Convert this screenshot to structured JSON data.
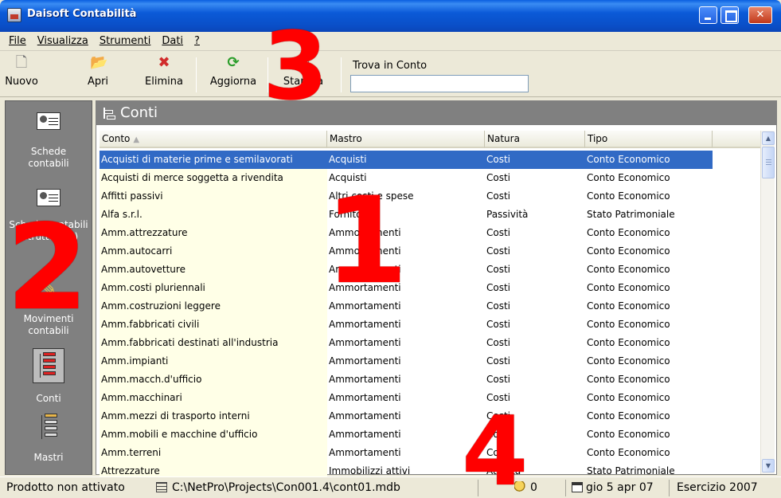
{
  "window": {
    "title": "Daisoft Contabilità"
  },
  "menu": [
    "File",
    "Visualizza",
    "Strumenti",
    "Dati",
    "?"
  ],
  "toolbar": {
    "new_label": "Nuovo",
    "open_label": "Apri",
    "delete_label": "Elimina",
    "refresh_label": "Aggiorna",
    "print_label": "Stampa",
    "find_label": "Trova in Conto",
    "find_value": ""
  },
  "sidebar": {
    "items": [
      {
        "label": "Schede contabili",
        "icon": "account-card-icon"
      },
      {
        "label": "Schede contabili (strutturate)",
        "icon": "account-card-icon"
      },
      {
        "label": "Movimenti contabili",
        "icon": "pencil-icon"
      },
      {
        "label": "Conti",
        "icon": "tree-red-icon"
      },
      {
        "label": "Mastri",
        "icon": "tree-icon"
      }
    ]
  },
  "panel": {
    "title": "Conti"
  },
  "table": {
    "columns": [
      "Conto",
      "Mastro",
      "Natura",
      "Tipo"
    ],
    "sort_indicator": "▲",
    "rows": [
      [
        "Acquisti di materie prime e semilavorati",
        "Acquisti",
        "Costi",
        "Conto Economico"
      ],
      [
        "Acquisti di merce soggetta a rivendita",
        "Acquisti",
        "Costi",
        "Conto Economico"
      ],
      [
        "Affitti passivi",
        "Altri costi e spese",
        "Costi",
        "Conto Economico"
      ],
      [
        "Alfa s.r.l.",
        "Fornitori",
        "Passività",
        "Stato Patrimoniale"
      ],
      [
        "Amm.attrezzature",
        "Ammortamenti",
        "Costi",
        "Conto Economico"
      ],
      [
        "Amm.autocarri",
        "Ammortamenti",
        "Costi",
        "Conto Economico"
      ],
      [
        "Amm.autovetture",
        "Ammortamenti",
        "Costi",
        "Conto Economico"
      ],
      [
        "Amm.costi pluriennali",
        "Ammortamenti",
        "Costi",
        "Conto Economico"
      ],
      [
        "Amm.costruzioni leggere",
        "Ammortamenti",
        "Costi",
        "Conto Economico"
      ],
      [
        "Amm.fabbricati civili",
        "Ammortamenti",
        "Costi",
        "Conto Economico"
      ],
      [
        "Amm.fabbricati destinati all'industria",
        "Ammortamenti",
        "Costi",
        "Conto Economico"
      ],
      [
        "Amm.impianti",
        "Ammortamenti",
        "Costi",
        "Conto Economico"
      ],
      [
        "Amm.macch.d'ufficio",
        "Ammortamenti",
        "Costi",
        "Conto Economico"
      ],
      [
        "Amm.macchinari",
        "Ammortamenti",
        "Costi",
        "Conto Economico"
      ],
      [
        "Amm.mezzi di trasporto interni",
        "Ammortamenti",
        "Costi",
        "Conto Economico"
      ],
      [
        "Amm.mobili e macchine d'ufficio",
        "Ammortamenti",
        "Costi",
        "Conto Economico"
      ],
      [
        "Amm.terreni",
        "Ammortamenti",
        "Costi",
        "Conto Economico"
      ],
      [
        "Attrezzature",
        "Immobilizzi attivi",
        "Attività",
        "Stato Patrimoniale"
      ]
    ],
    "selected_row": 0
  },
  "status": {
    "activation": "Prodotto non attivato",
    "db_path": "C:\\NetPro\\Projects\\Con001.4\\cont01.mdb",
    "count": "0",
    "date": "gio 5 apr 07",
    "fiscal_year": "Esercizio 2007"
  },
  "annotations": [
    "1",
    "2",
    "3",
    "4"
  ],
  "colors": {
    "selection": "#316ac5",
    "annotation": "#ff0000",
    "panel_gray": "#808080",
    "titlebar": "#0a5fe0"
  }
}
